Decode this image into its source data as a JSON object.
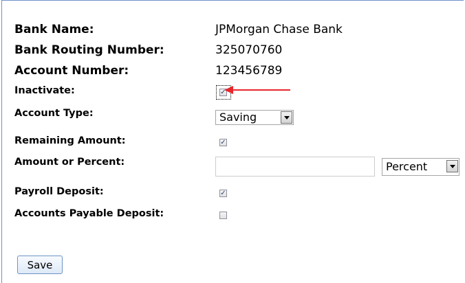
{
  "bank": {
    "name_label": "Bank Name:",
    "name_value": "JPMorgan Chase Bank",
    "routing_label": "Bank Routing Number:",
    "routing_value": "325070760",
    "account_label": "Account Number:",
    "account_value": "123456789"
  },
  "form": {
    "inactivate_label": "Inactivate:",
    "inactivate_checked": true,
    "account_type_label": "Account Type:",
    "account_type_value": "Saving",
    "remaining_label": "Remaining Amount:",
    "remaining_checked": true,
    "amount_label": "Amount or Percent:",
    "amount_value": "",
    "amount_unit_value": "Percent",
    "payroll_label": "Payroll Deposit:",
    "payroll_checked": true,
    "ap_label": "Accounts Payable Deposit:",
    "ap_checked": false
  },
  "actions": {
    "save_label": "Save"
  },
  "colors": {
    "border_accent": "#6f8fc8",
    "annotation_arrow": "#e8262b",
    "button_border": "#6c93c4"
  }
}
